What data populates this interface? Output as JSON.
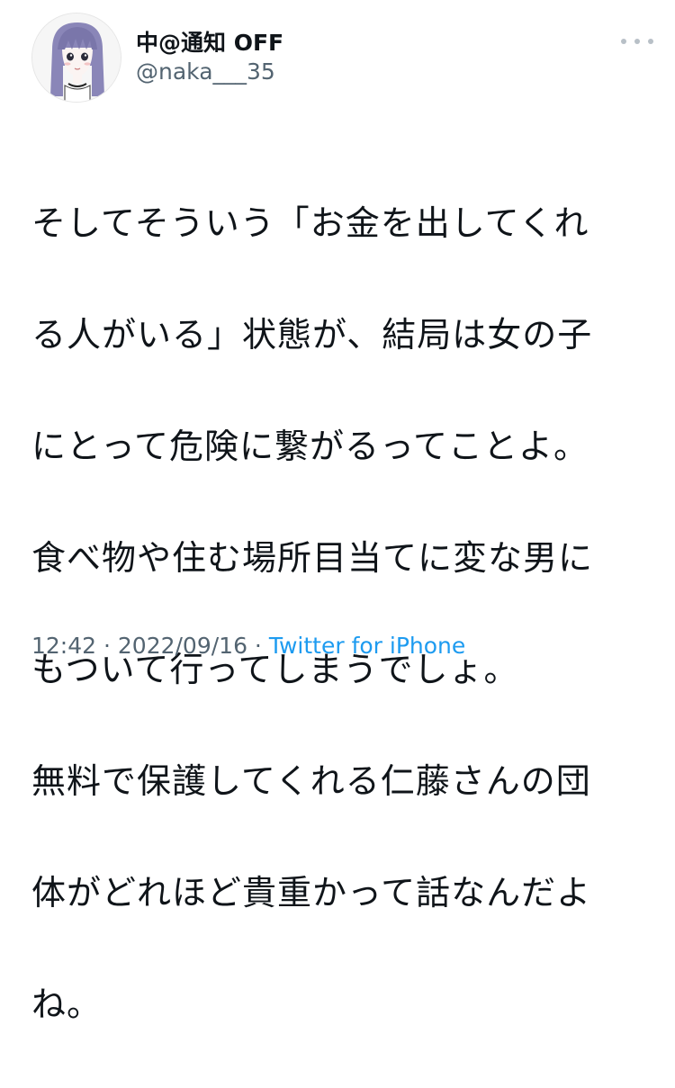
{
  "author": {
    "display_name": "中@通知 OFF",
    "handle": "@naka___35",
    "avatar_icon": "anime-girl-avatar"
  },
  "more_menu": {
    "icon": "more-horizontal-icon"
  },
  "tweet": {
    "text": "そしてそういう「お金を出してくれる人がいる」状態が、結局は女の子にとって危険に繋がるってことよ。\n食べ物や住む場所目当てに変な男にもついて行ってしまうでしょ。\n無料で保護してくれる仁藤さんの団体がどれほど貴重かって話なんだよね。",
    "lines": [
      "そしてそういう「お金を出してくれ",
      "る人がいる」状態が、結局は女の子",
      "にとって危険に繋がるってことよ。",
      "食べ物や住む場所目当てに変な男に",
      "もついて行ってしまうでしょ。",
      "無料で保護してくれる仁藤さんの団",
      "体がどれほど貴重かって話なんだよ",
      "ね。"
    ],
    "time": "12:42",
    "separator_1": " · ",
    "date": "2022/09/16",
    "separator_2": " · ",
    "source": "Twitter for iPhone"
  },
  "colors": {
    "text": "#0f1419",
    "secondary": "#536471",
    "link": "#1d9bf0"
  }
}
